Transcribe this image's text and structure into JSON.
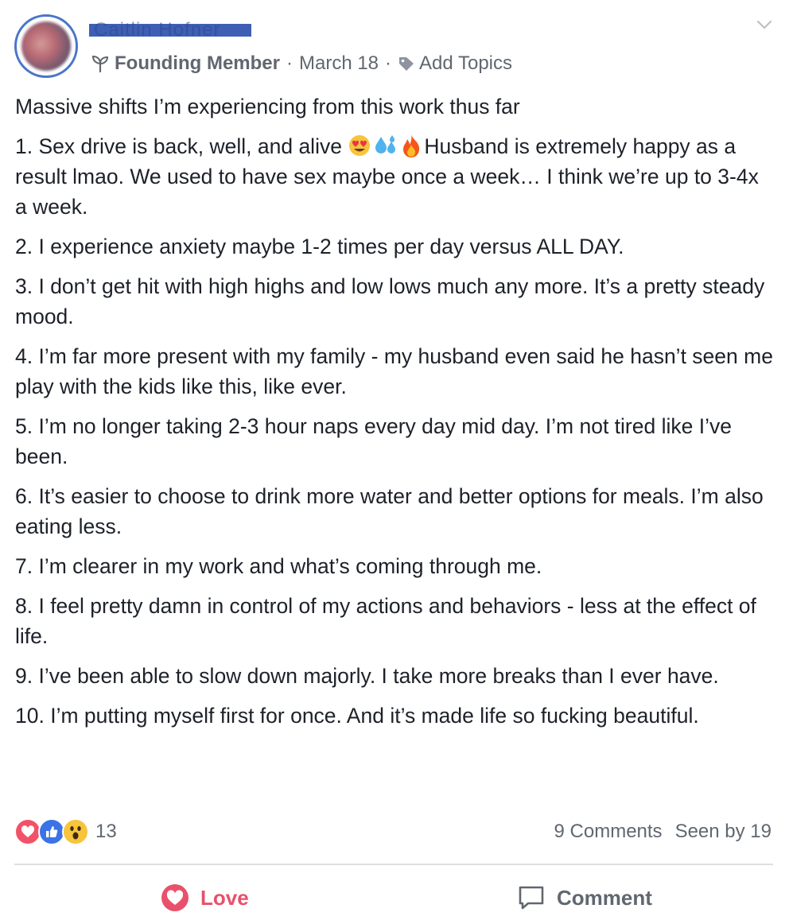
{
  "author": {
    "name_redacted": "Caitlin Hofner",
    "badge": "Founding Member",
    "date": "March 18",
    "add_topics": "Add Topics"
  },
  "post": {
    "intro": "Massive shifts I’m experiencing from this work thus far",
    "item1_a": "1. Sex drive is back, well, and alive ",
    "item1_b": "Husband is extremely happy as a result lmao. We used to have sex maybe once a week… I think we’re up to 3-4x a week.",
    "items": [
      "2. I experience anxiety maybe 1-2 times per day versus ALL DAY.",
      "3. I don’t get hit with high highs and low lows much any more. It’s a pretty steady mood.",
      "4. I’m far more present with my family - my husband even said he hasn’t seen me play with the kids like this, like ever.",
      "5. I’m no longer taking 2-3 hour naps every day mid day. I’m not tired like I’ve been.",
      "6. It’s easier to choose to drink more water and better options for meals. I’m also eating less.",
      "7. I’m clearer in my work and what’s coming through me.",
      "8. I feel pretty damn in control of my actions and behaviors - less at the effect of life.",
      "9. I’ve been able to slow down majorly. I take more breaks than I ever have.",
      "10. I’m putting myself first for once. And it’s made life so fucking beautiful."
    ]
  },
  "footer": {
    "reaction_count": "13",
    "comments": "9 Comments",
    "seen_by": "Seen by 19",
    "love_label": "Love",
    "comment_label": "Comment"
  },
  "colors": {
    "love": "#e8516b",
    "like": "#3b73e6",
    "avatar_ring": "#4a76c9",
    "meta_text": "#606770"
  }
}
